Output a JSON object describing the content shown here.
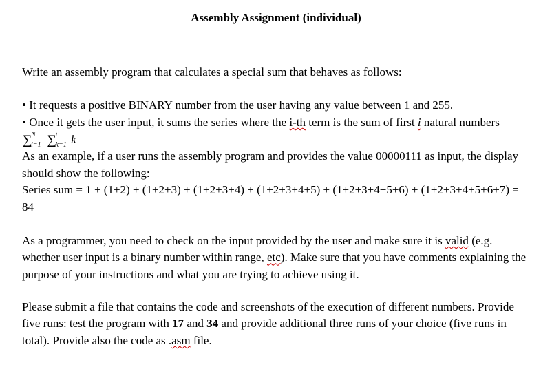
{
  "title": "Assembly Assignment (individual)",
  "intro": "Write an assembly program that calculates a special sum that behaves as follows:",
  "bullet1": "• It requests a positive BINARY number from the user having any value between 1 and 255.",
  "bullet2_pre": "• Once it gets the user input, it sums the series where the ",
  "bullet2_ith": "i-th",
  "bullet2_mid": " term is the sum of first ",
  "bullet2_i": "i",
  "bullet2_post": " natural numbers ",
  "formula": {
    "sup1": "N",
    "sub1": "i=1",
    "sup2": "i",
    "sub2": "k=1",
    "var": "k"
  },
  "example_line1": "As an example, if a user runs the assembly program and provides the value 00000111 as input, the display should show the following:",
  "example_line2": "Series sum = 1 + (1+2) + (1+2+3) + (1+2+3+4) + (1+2+3+4+5) + (1+2+3+4+5+6) + (1+2+3+4+5+6+7) = 84",
  "validity_pre": "As a programmer, you need to check on the input provided by the user and make sure it is ",
  "validity_valid": "valid",
  "validity_mid": " (e.g. whether user input is a binary number within range, ",
  "validity_etc": "etc",
  "validity_post": "). Make sure that you have comments explaining the purpose of your instructions and what you are trying to achieve using it.",
  "submit_pre": "Please submit a file that contains the code and screenshots of the execution of different numbers. Provide five runs: test the program with ",
  "submit_17": "17",
  "submit_and": " and ",
  "submit_34": "34",
  "submit_mid": " and provide additional three runs of your choice (five runs in total).   Provide also the code as .",
  "submit_asm": "asm",
  "submit_post": " file."
}
